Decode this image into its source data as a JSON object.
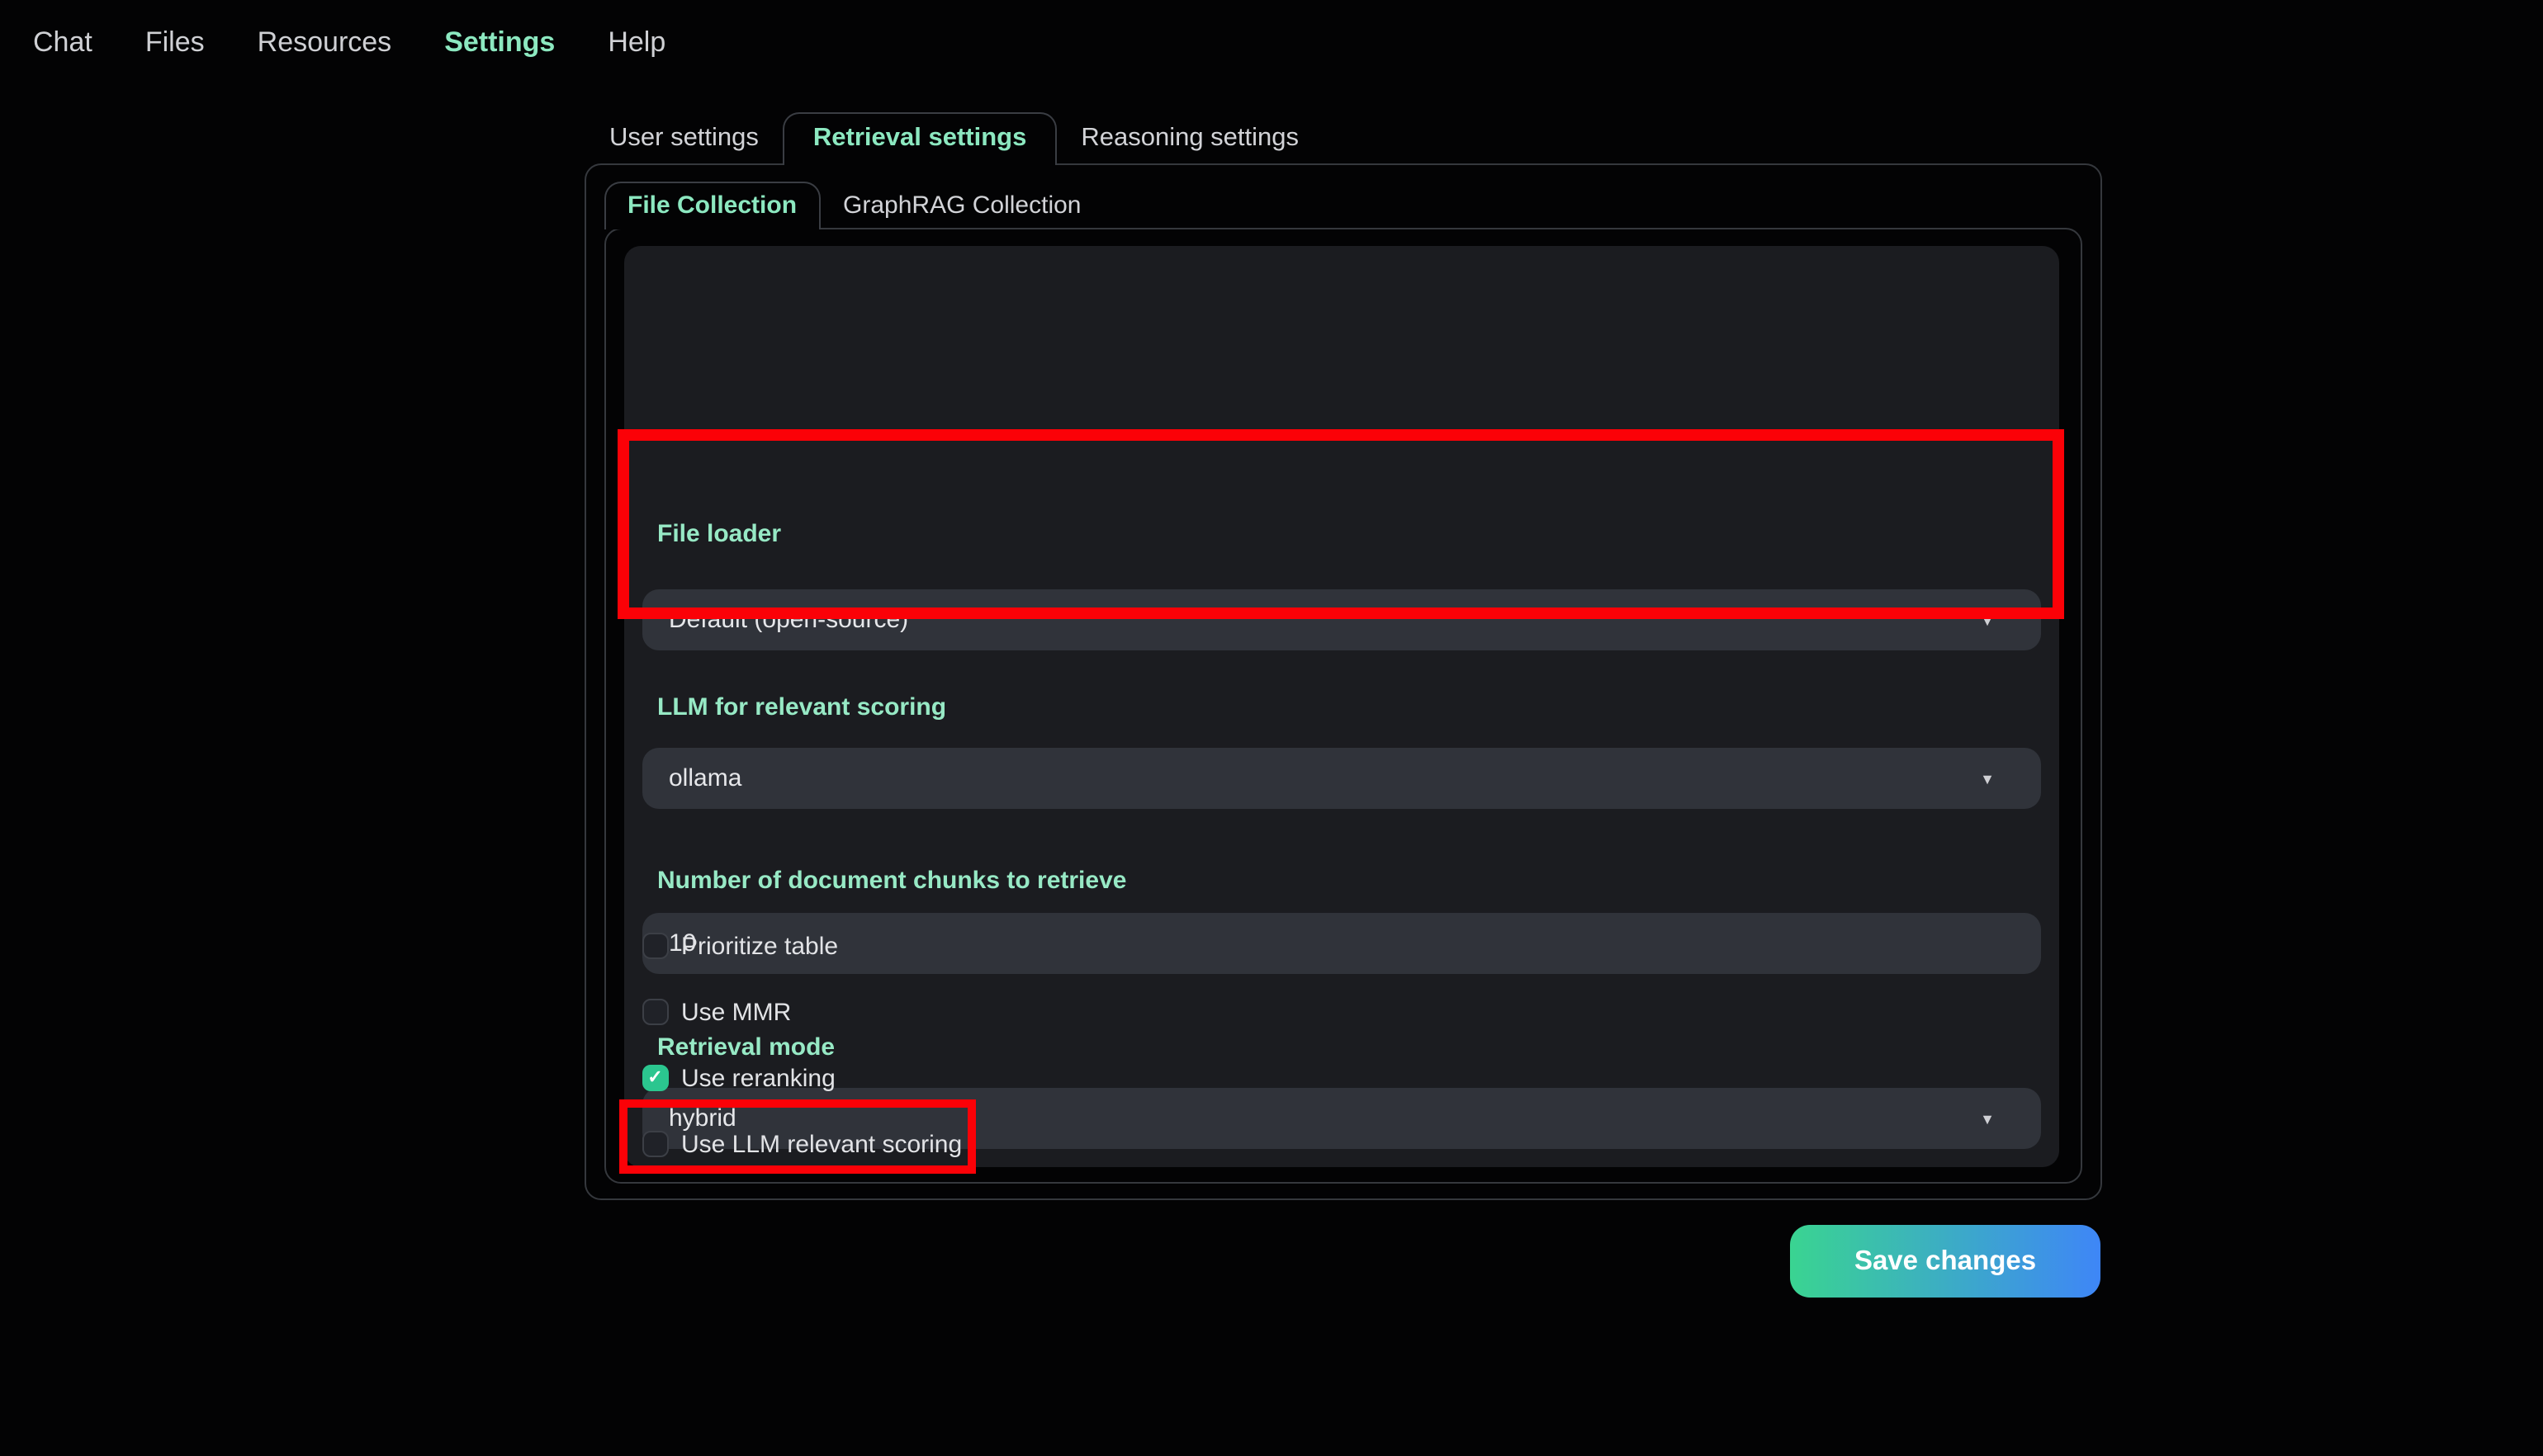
{
  "nav": {
    "items": [
      {
        "label": "Chat"
      },
      {
        "label": "Files"
      },
      {
        "label": "Resources"
      },
      {
        "label": "Settings"
      },
      {
        "label": "Help"
      }
    ],
    "active": "Settings"
  },
  "tabs": {
    "items": [
      {
        "label": "User settings"
      },
      {
        "label": "Retrieval settings"
      },
      {
        "label": "Reasoning settings"
      }
    ],
    "active": "Retrieval settings"
  },
  "subtabs": {
    "items": [
      {
        "label": "File Collection"
      },
      {
        "label": "GraphRAG Collection"
      }
    ],
    "active": "File Collection"
  },
  "form": {
    "file_loader": {
      "label": "File loader",
      "value": "Default (open-source)"
    },
    "llm_scoring": {
      "label": "LLM for relevant scoring",
      "value": "ollama"
    },
    "num_chunks": {
      "label": "Number of document chunks to retrieve",
      "value": "10"
    },
    "retrieval_mode": {
      "label": "Retrieval mode",
      "value": "hybrid"
    },
    "checkboxes": [
      {
        "label": "Prioritize table",
        "checked": false
      },
      {
        "label": "Use MMR",
        "checked": false
      },
      {
        "label": "Use reranking",
        "checked": true
      },
      {
        "label": "Use LLM relevant scoring",
        "checked": false
      }
    ]
  },
  "save_button": {
    "label": "Save changes"
  },
  "icons": {
    "check": "✓",
    "caret_down": "▼"
  },
  "colors": {
    "background": "#030304",
    "panel": "#1b1c20",
    "control_fill": "#30333a",
    "accent_mint": "#8ce8c0",
    "checked_green": "#2bc68f",
    "annotation_red": "#fb0107",
    "save_gradient_start": "#3ad491",
    "save_gradient_end": "#3e86f7"
  }
}
